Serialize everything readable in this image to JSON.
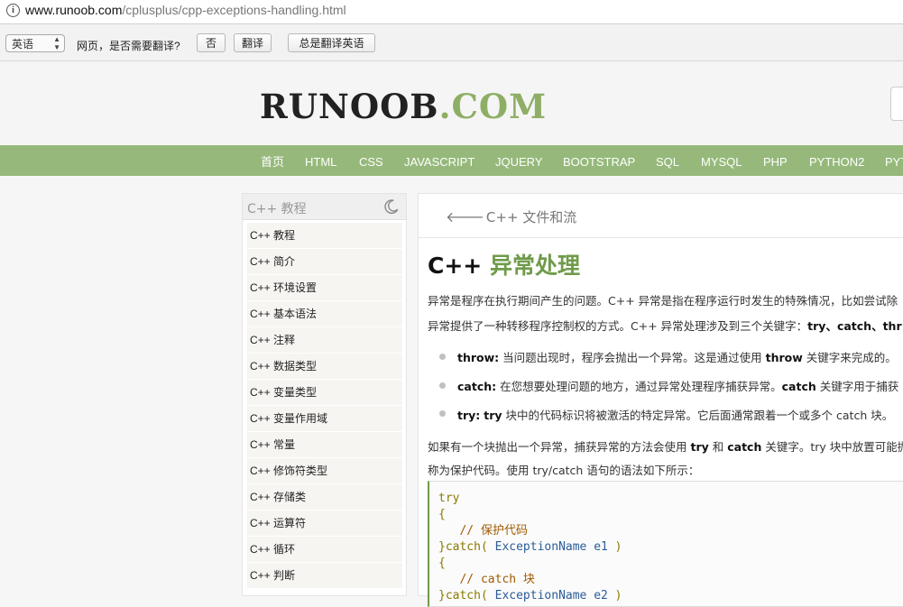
{
  "browser": {
    "url_host": "www.runoob.com",
    "url_path": "/cplusplus/cpp-exceptions-handling.html"
  },
  "translate_bar": {
    "language": "英语",
    "question": "网页，是否需要翻译?",
    "no_label": "否",
    "translate_label": "翻译",
    "always_label": "总是翻译英语"
  },
  "header": {
    "logo_dark": "RUNOOB",
    "logo_green": ".COM"
  },
  "nav": [
    "首页",
    "HTML",
    "CSS",
    "JAVASCRIPT",
    "JQUERY",
    "BOOTSTRAP",
    "SQL",
    "MYSQL",
    "PHP",
    "PYTHON2",
    "PYT"
  ],
  "sidebar": {
    "title": "C++ 教程",
    "items": [
      "C++ 教程",
      "C++ 简介",
      "C++ 环境设置",
      "C++ 基本语法",
      "C++ 注释",
      "C++ 数据类型",
      "C++ 变量类型",
      "C++ 变量作用域",
      "C++ 常量",
      "C++ 修饰符类型",
      "C++ 存储类",
      "C++ 运算符",
      "C++ 循环",
      "C++ 判断"
    ]
  },
  "main": {
    "prev_link": "C++ 文件和流",
    "title_prefix": "C++ ",
    "title_main": "异常处理",
    "p1": "异常是程序在执行期间产生的问题。C++ 异常是指在程序运行时发生的特殊情况，比如尝试除",
    "p2_text": "异常提供了一种转移程序控制权的方式。C++ 异常处理涉及到三个关键字：",
    "p2_kw": "try、catch、thr",
    "bullets": [
      {
        "kw": "throw:",
        "text": " 当问题出现时，程序会抛出一个异常。这是通过使用 ",
        "kw2": "throw",
        "text2": " 关键字来完成的。"
      },
      {
        "kw": "catch:",
        "text": " 在您想要处理问题的地方，通过异常处理程序捕获异常。",
        "kw2": "catch",
        "text2": " 关键字用于捕获"
      },
      {
        "kw": "try:",
        "text": " ",
        "kw2": "try",
        "text2": " 块中的代码标识将被激活的特定异常。它后面通常跟着一个或多个 catch 块。"
      }
    ],
    "p3_a": "如果有一个块抛出一个异常，捕获异常的方法会使用 ",
    "p3_try": "try",
    "p3_b": " 和 ",
    "p3_catch": "catch",
    "p3_c": " 关键字。try 块中放置可能抛",
    "p4": "称为保护代码。使用 try/catch 语句的语法如下所示：",
    "code": {
      "l1": "try",
      "l2": "{",
      "l3": "   // 保护代码",
      "l4_kw": "}catch(",
      "l4_cls": " ExceptionName e1",
      "l4_end": " )",
      "l5": "{",
      "l6": "   // catch 块",
      "l7_kw": "}catch(",
      "l7_cls": " ExceptionName e2",
      "l7_end": " )"
    }
  }
}
